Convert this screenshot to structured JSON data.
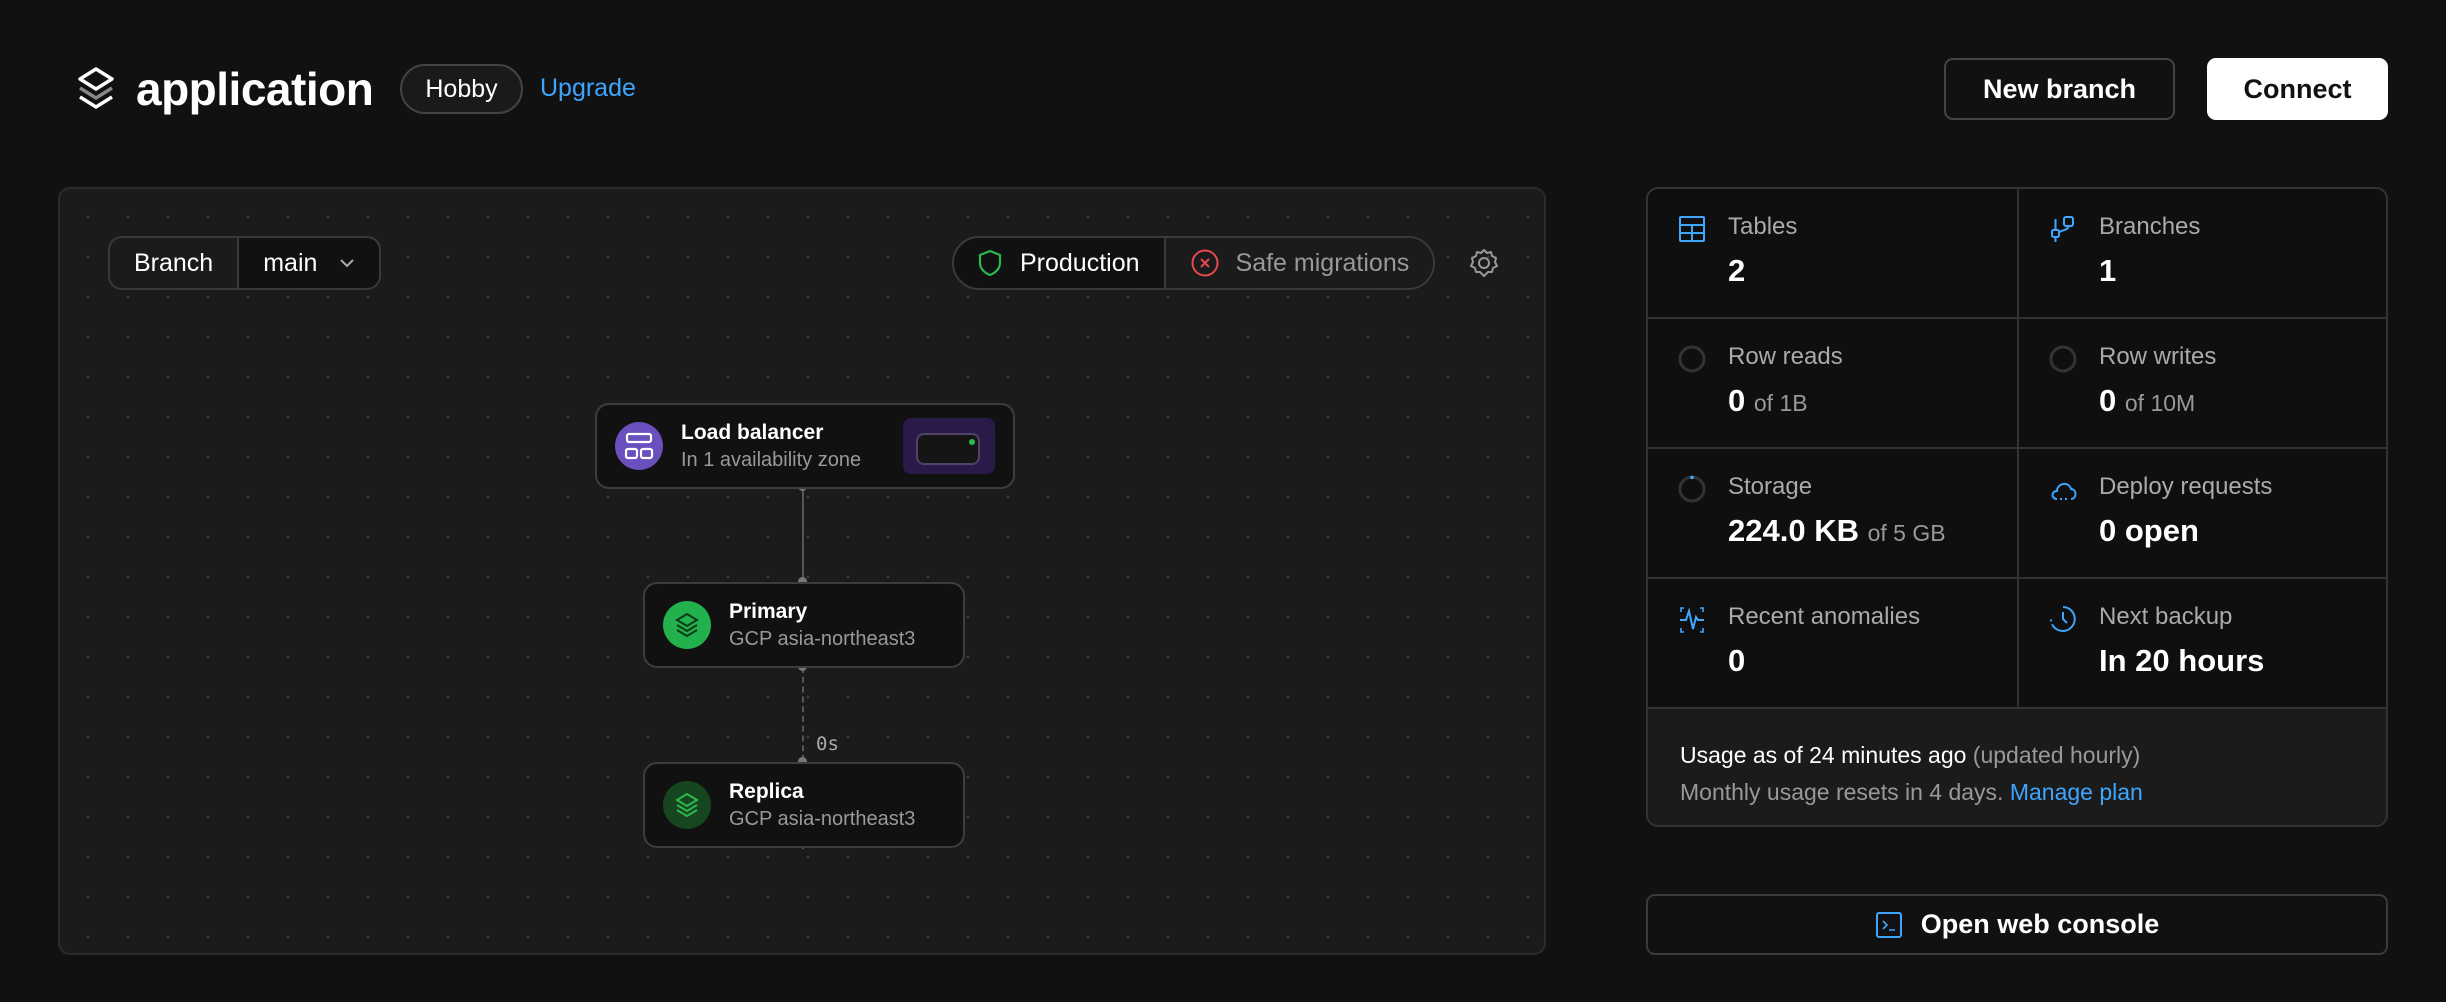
{
  "header": {
    "title": "application",
    "plan_badge": "Hobby",
    "upgrade_link": "Upgrade",
    "new_branch_button": "New branch",
    "connect_button": "Connect"
  },
  "canvas": {
    "branch_label": "Branch",
    "branch_value": "main",
    "production_label": "Production",
    "safe_migrations_label": "Safe migrations",
    "nodes": [
      {
        "title": "Load balancer",
        "subtitle": "In 1 availability zone"
      },
      {
        "title": "Primary",
        "subtitle": "GCP asia-northeast3"
      },
      {
        "title": "Replica",
        "subtitle": "GCP asia-northeast3"
      }
    ],
    "replication_lag": "0s"
  },
  "stats": [
    {
      "label": "Tables",
      "value": "2",
      "suffix": "",
      "icon": "table-icon"
    },
    {
      "label": "Branches",
      "value": "1",
      "suffix": "",
      "icon": "branch-icon"
    },
    {
      "label": "Row reads",
      "value": "0",
      "suffix": "of 1B",
      "icon": "progress-ring-icon"
    },
    {
      "label": "Row writes",
      "value": "0",
      "suffix": "of 10M",
      "icon": "progress-ring-icon"
    },
    {
      "label": "Storage",
      "value": "224.0 KB",
      "suffix": "of 5 GB",
      "icon": "progress-ring-icon"
    },
    {
      "label": "Deploy requests",
      "value": "0 open",
      "suffix": "",
      "icon": "cloud-icon"
    },
    {
      "label": "Recent anomalies",
      "value": "0",
      "suffix": "",
      "icon": "pulse-icon"
    },
    {
      "label": "Next backup",
      "value": "In 20 hours",
      "suffix": "",
      "icon": "clock-icon"
    }
  ],
  "usage": {
    "line1": "Usage as of 24 minutes ago",
    "line1_note": "(updated hourly)",
    "line2": "Monthly usage resets in 4 days.",
    "manage_link": "Manage plan"
  },
  "console_button": "Open web console",
  "colors": {
    "accent": "#3ea6ff",
    "primary_node": "#22b14c",
    "replica_node": "#15461f",
    "load_balancer": "#6a4fbf",
    "production_shield": "#2db84d",
    "safe_migrations_off": "#e5484d"
  }
}
